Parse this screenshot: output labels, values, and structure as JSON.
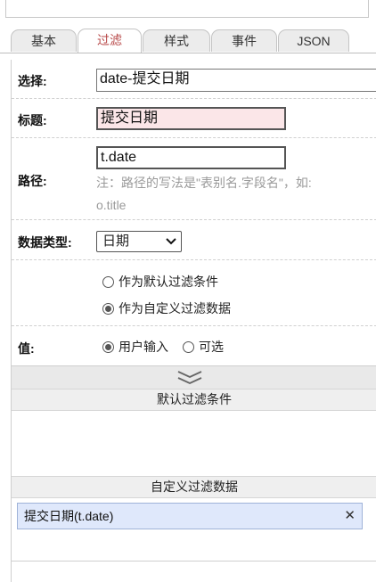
{
  "tabs": [
    {
      "label": "基本",
      "active": false
    },
    {
      "label": "过滤",
      "active": true
    },
    {
      "label": "样式",
      "active": false
    },
    {
      "label": "事件",
      "active": false
    },
    {
      "label": "JSON",
      "active": false
    }
  ],
  "form": {
    "select_label": "选择:",
    "select_value": "date-提交日期",
    "title_label": "标题:",
    "title_value": "提交日期",
    "path_label": "路径:",
    "path_value": "t.date",
    "path_hint_line1": "注：路径的写法是\"表别名.字段名\"，如:",
    "path_hint_line2": "o.title",
    "datatype_label": "数据类型:",
    "datatype_value": "日期",
    "filter_option_default": "作为默认过滤条件",
    "filter_option_custom": "作为自定义过滤数据",
    "value_label": "值:",
    "value_option_user_input": "用户输入",
    "value_option_optional": "可选"
  },
  "sections": {
    "default_filter_title": "默认过滤条件",
    "custom_filter_title": "自定义过滤数据",
    "custom_filter_items": [
      {
        "label": "提交日期(t.date)"
      }
    ]
  },
  "icons": {
    "collapse": "double-chevron-down-icon",
    "remove": "close-icon",
    "dropdown": "chevron-down-icon"
  },
  "colors": {
    "active_tab_text": "#b84a4a",
    "title_input_bg": "#fbe6e8",
    "chip_bg": "#dfe8fb"
  }
}
